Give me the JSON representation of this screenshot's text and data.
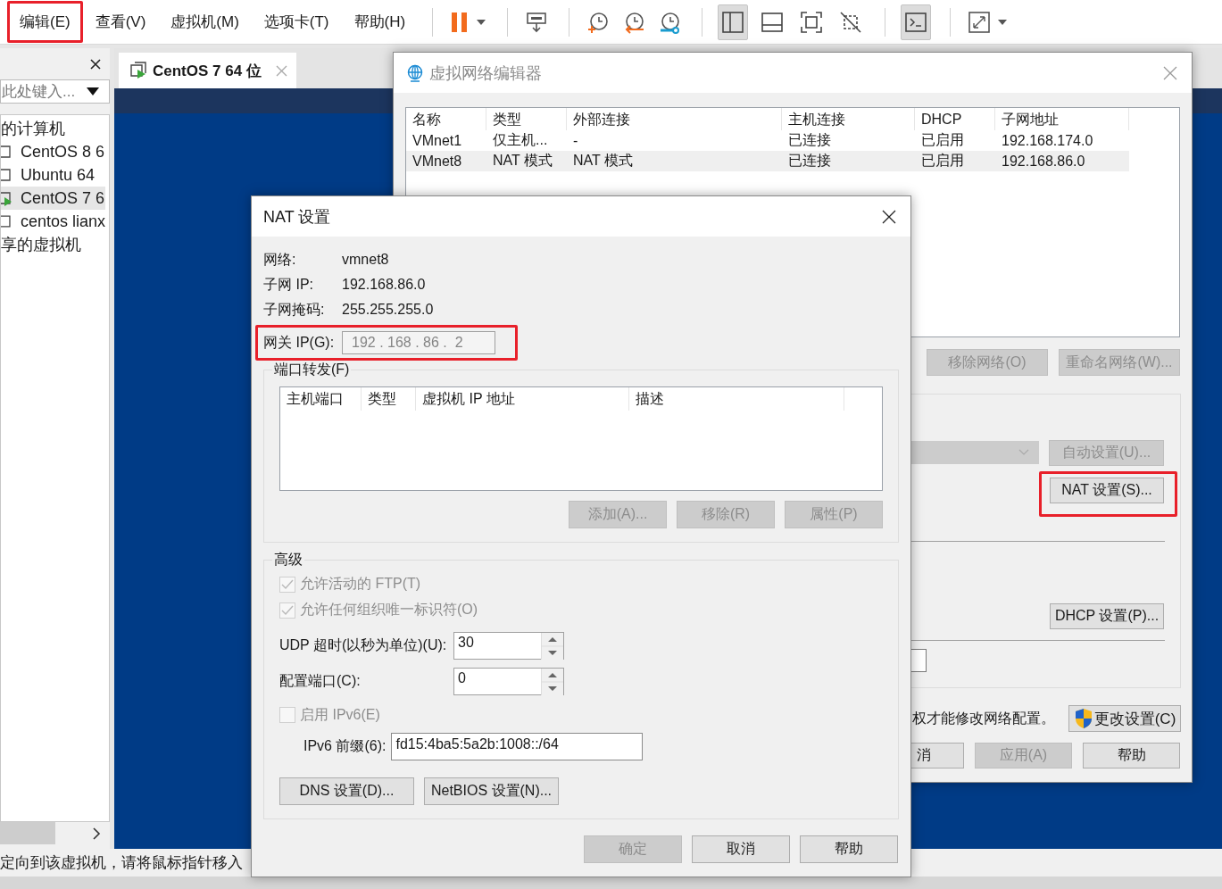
{
  "menu_bar": {
    "items": [
      {
        "label": "编辑(E)",
        "annotated": true
      },
      {
        "label": "查看(V)",
        "annotated": false
      },
      {
        "label": "虚拟机(M)",
        "annotated": false
      },
      {
        "label": "选项卡(T)",
        "annotated": false
      },
      {
        "label": "帮助(H)",
        "annotated": false
      }
    ]
  },
  "toolbar": {
    "layout_buttons": [
      {
        "selected": true
      },
      {
        "selected": false
      },
      {
        "selected": false
      },
      {
        "selected": false
      }
    ],
    "console_button": {
      "selected": true
    }
  },
  "library": {
    "search": {
      "placeholder": "此处键入..."
    },
    "tree": [
      {
        "label": "的计算机",
        "children": [
          {
            "label": "CentOS 8 6",
            "running": false,
            "selected": false
          },
          {
            "label": "Ubuntu 64",
            "running": false,
            "selected": false
          },
          {
            "label": "CentOS 7 6",
            "running": true,
            "selected": true
          },
          {
            "label": "centos lianx",
            "running": false,
            "selected": false
          }
        ]
      },
      {
        "label": "享的虚拟机"
      }
    ]
  },
  "vm_tab": {
    "label": "CentOS 7 64 位",
    "running": true
  },
  "status_bar": {
    "text": "定向到该虚拟机，请将鼠标指针移入"
  },
  "network_editor": {
    "title": "虚拟网络编辑器",
    "table": {
      "columns": [
        "名称",
        "类型",
        "外部连接",
        "主机连接",
        "DHCP",
        "子网地址"
      ],
      "rows": [
        {
          "cells": [
            "VMnet1",
            "仅主机...",
            "-",
            "已连接",
            "已启用",
            "192.168.174.0"
          ],
          "selected": false
        },
        {
          "cells": [
            "VMnet8",
            "NAT 模式",
            "NAT 模式",
            "已连接",
            "已启用",
            "192.168.86.0"
          ],
          "selected": true
        }
      ]
    },
    "buttons": [
      {
        "label": "移除网络(O)",
        "disabled": true,
        "annotated": false
      },
      {
        "label": "重命名网络(W)...",
        "disabled": true,
        "annotated": false
      },
      {
        "label": "自动设置(U)...",
        "disabled": true,
        "annotated": false
      },
      {
        "label": "NAT 设置(S)...",
        "disabled": false,
        "annotated": true
      },
      {
        "label": "DHCP 设置(P)...",
        "disabled": false,
        "annotated": false
      }
    ],
    "dropdown": {
      "disabled": true
    },
    "admin_note": "权才能修改网络配置。",
    "change_settings_button": {
      "label": "更改设置(C)"
    },
    "footer_buttons": [
      {
        "label": "消",
        "disabled": false
      },
      {
        "label": "应用(A)",
        "disabled": true
      },
      {
        "label": "帮助",
        "disabled": false
      }
    ]
  },
  "nat_dialog": {
    "title": "NAT 设置",
    "info": [
      {
        "label": "网络:",
        "value": "vmnet8"
      },
      {
        "label": "子网 IP:",
        "value": "192.168.86.0"
      },
      {
        "label": "子网掩码:",
        "value": "255.255.255.0"
      }
    ],
    "gateway": {
      "label": "网关 IP(G):",
      "value": "192 . 168 . 86 .  2",
      "disabled": true,
      "annotated": true
    },
    "port_forwarding": {
      "legend": "端口转发(F)",
      "columns": [
        "主机端口",
        "类型",
        "虚拟机 IP 地址",
        "描述"
      ],
      "buttons": [
        {
          "label": "添加(A)...",
          "disabled": true
        },
        {
          "label": "移除(R)",
          "disabled": true
        },
        {
          "label": "属性(P)",
          "disabled": true
        }
      ]
    },
    "advanced": {
      "legend": "高级",
      "checkboxes": [
        {
          "label": "允许活动的 FTP(T)",
          "checked": true,
          "disabled": true
        },
        {
          "label": "允许任何组织唯一标识符(O)",
          "checked": true,
          "disabled": true
        }
      ],
      "udp_timeout": {
        "label": "UDP 超时(以秒为单位)(U):",
        "value": "30"
      },
      "config_port": {
        "label": "配置端口(C):",
        "value": "0"
      },
      "ipv6": {
        "label": "启用 IPv6(E)",
        "checked": false,
        "disabled": true
      },
      "ipv6_prefix": {
        "label": "IPv6 前缀(6):",
        "value": "fd15:4ba5:5a2b:1008::/64"
      },
      "buttons": [
        {
          "label": "DNS 设置(D)..."
        },
        {
          "label": "NetBIOS 设置(N)..."
        }
      ]
    },
    "footer_buttons": [
      {
        "label": "确定",
        "disabled": true
      },
      {
        "label": "取消",
        "disabled": false
      },
      {
        "label": "帮助",
        "disabled": false
      }
    ]
  }
}
